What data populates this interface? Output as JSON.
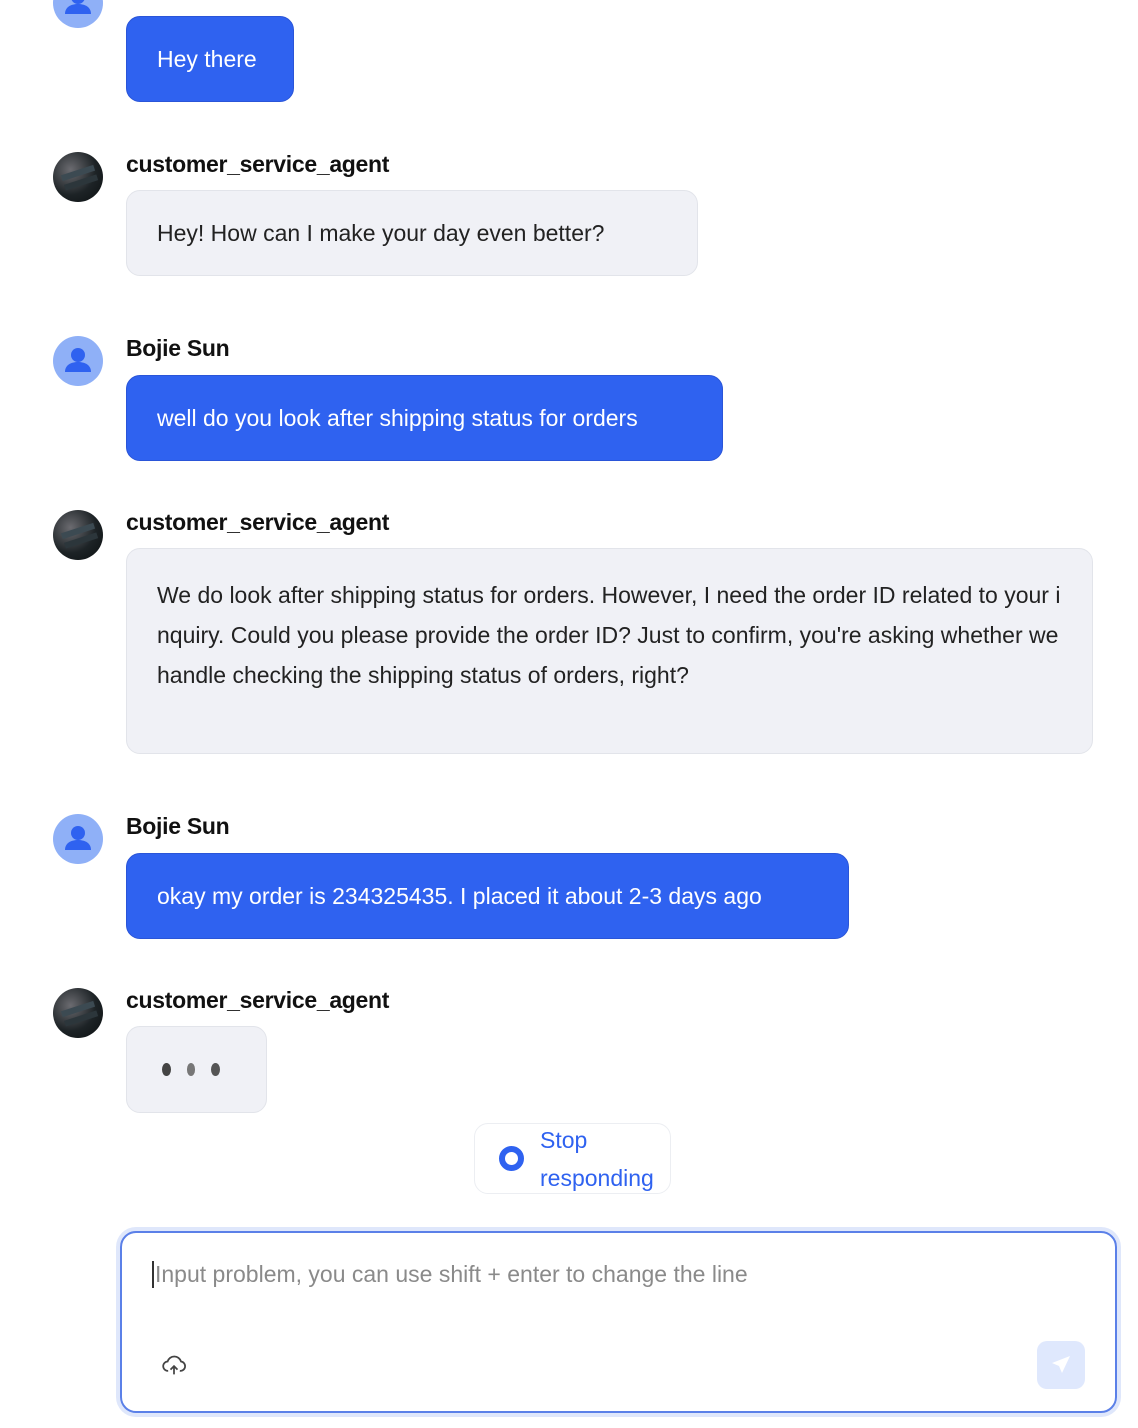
{
  "messages": [
    {
      "role": "user",
      "name": "",
      "text": "Hey there"
    },
    {
      "role": "agent",
      "name": "customer_service_agent",
      "text": "Hey! How can I make your day even better?"
    },
    {
      "role": "user",
      "name": "Bojie Sun",
      "text": "well do you look after shipping status for orders"
    },
    {
      "role": "agent",
      "name": "customer_service_agent",
      "text": "We do look after shipping status for orders. However, I need the order ID related to your inquiry. Could you please provide the order ID? Just to confirm, you're asking whether we handle checking the shipping status of orders, right?"
    },
    {
      "role": "user",
      "name": "Bojie Sun",
      "text": "okay my order is 234325435. I placed it about 2-3 days ago"
    },
    {
      "role": "agent",
      "name": "customer_service_agent",
      "typing": true
    }
  ],
  "stop_button": {
    "label": "Stop responding",
    "icon": "stop-circle-icon"
  },
  "input": {
    "placeholder": "Input problem, you can use shift + enter to change the line",
    "value": ""
  },
  "icons": {
    "upload": "cloud-upload-icon",
    "send": "send-icon"
  },
  "colors": {
    "accent": "#2f62f0",
    "bot_bubble": "#f0f1f6"
  }
}
